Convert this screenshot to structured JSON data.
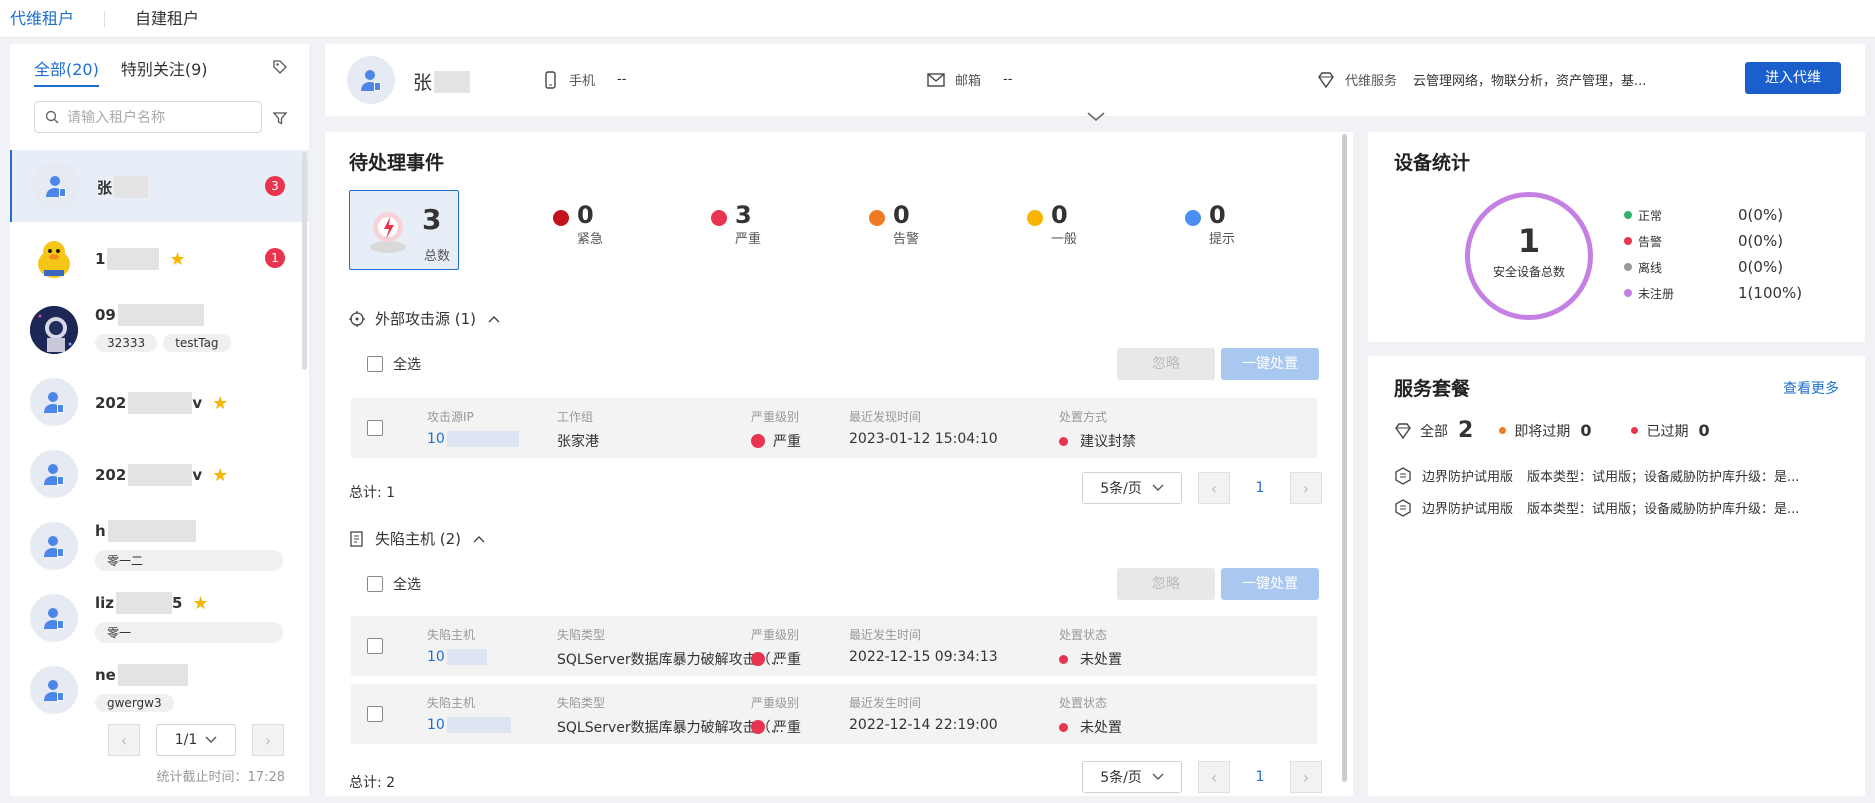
{
  "topnav": {
    "tabs": [
      "代维租户",
      "自建租户"
    ]
  },
  "left": {
    "tabs": [
      "全部(20)",
      "特别关注(9)"
    ],
    "search_placeholder": "请输入租户名称",
    "tenants": [
      {
        "name": "张",
        "badge": "3",
        "tags": []
      },
      {
        "name": "1",
        "badge": "1",
        "tags": []
      },
      {
        "name": "09",
        "badge": "",
        "tags": [
          "32333",
          "testTag"
        ]
      },
      {
        "name": "202",
        "suffix": "v",
        "badge": "",
        "tags": []
      },
      {
        "name": "202",
        "suffix": "v",
        "badge": "",
        "tags": []
      },
      {
        "name": "h",
        "badge": "",
        "tags": [
          "零一二"
        ]
      },
      {
        "name": "liz",
        "suffix": "5",
        "badge": "",
        "tags": [
          "零一"
        ]
      },
      {
        "name": "ne",
        "badge": "",
        "tags": [
          "gwergw3"
        ]
      }
    ],
    "pager": {
      "page": "1/1"
    },
    "stamp": "统计截止时间：17:28"
  },
  "header": {
    "name": "张",
    "phone_label": "手机",
    "phone": "--",
    "email_label": "邮箱",
    "email": "--",
    "service_label": "代维服务",
    "service_value": "云管理网络，物联分析，资产管理，基...",
    "enter_button": "进入代维"
  },
  "events": {
    "title": "待处理事件",
    "total_num": "3",
    "total_label": "总数",
    "levels": [
      {
        "label": "紧急",
        "value": "0",
        "color": "#c0131c"
      },
      {
        "label": "严重",
        "value": "3",
        "color": "#e8344e"
      },
      {
        "label": "告警",
        "value": "0",
        "color": "#f07a22"
      },
      {
        "label": "一般",
        "value": "0",
        "color": "#f7b500"
      },
      {
        "label": "提示",
        "value": "0",
        "color": "#4c8ef2"
      }
    ],
    "attack": {
      "title": "外部攻击源 (1)",
      "select_all": "全选",
      "ignore": "忽略",
      "one_click": "一键处置",
      "headers": [
        "攻击源IP",
        "工作组",
        "严重级别",
        "最近发现时间",
        "处置方式"
      ],
      "rows": [
        {
          "ip": "10",
          "group": "张家港",
          "level": "严重",
          "time": "2023-01-12 15:04:10",
          "action": "建议封禁"
        }
      ],
      "total": "总计: 1",
      "page_size": "5条/页",
      "page": "1"
    },
    "hosts": {
      "title": "失陷主机 (2)",
      "select_all": "全选",
      "ignore": "忽略",
      "one_click": "一键处置",
      "headers": [
        "失陷主机",
        "失陷类型",
        "严重级别",
        "最近发生时间",
        "处置状态"
      ],
      "rows": [
        {
          "host": "10",
          "type": "SQLServer数据库暴力破解攻击（...",
          "level": "严重",
          "time": "2022-12-15 09:34:13",
          "status": "未处置"
        },
        {
          "host": "10",
          "type": "SQLServer数据库暴力破解攻击（...",
          "level": "严重",
          "time": "2022-12-14 22:19:00",
          "status": "未处置"
        }
      ],
      "total": "总计: 2",
      "page_size": "5条/页",
      "page": "1"
    }
  },
  "stats": {
    "title": "设备统计",
    "total": "1",
    "total_label": "安全设备总数",
    "legend": [
      {
        "label": "正常",
        "value": "0(0%)",
        "color": "#2fb36b"
      },
      {
        "label": "告警",
        "value": "0(0%)",
        "color": "#e8344e"
      },
      {
        "label": "离线",
        "value": "0(0%)",
        "color": "#999999"
      },
      {
        "label": "未注册",
        "value": "1(100%)",
        "color": "#c481e3"
      }
    ]
  },
  "services": {
    "title": "服务套餐",
    "more": "查看更多",
    "all_label": "全部",
    "all_value": "2",
    "expiring_label": "即将过期",
    "expiring_value": "0",
    "expired_label": "已过期",
    "expired_value": "0",
    "packages": [
      {
        "name": "边界防护试用版",
        "desc": "版本类型：试用版；设备威胁防护库升级：是..."
      },
      {
        "name": "边界防护试用版",
        "desc": "版本类型：试用版；设备威胁防护库升级：是..."
      }
    ]
  }
}
